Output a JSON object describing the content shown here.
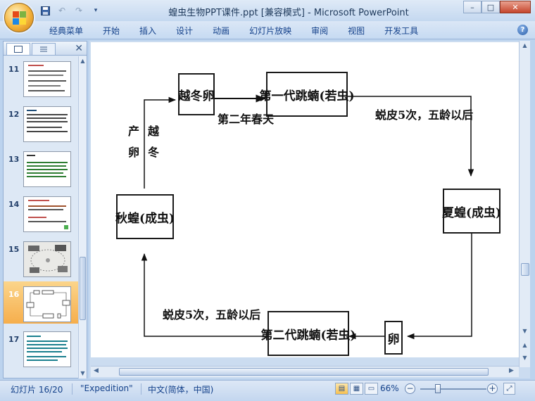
{
  "window": {
    "title": "蝗虫生物PPT课件.ppt [兼容模式] - Microsoft PowerPoint",
    "controls": {
      "minimize": "–",
      "maximize": "□",
      "close": "✕"
    }
  },
  "quick_access": {
    "save_icon": "save-icon",
    "undo_icon": "undo-icon",
    "redo_icon": "redo-icon",
    "customize_icon": "dropdown-icon"
  },
  "ribbon": {
    "tabs": [
      "经典菜单",
      "开始",
      "插入",
      "设计",
      "动画",
      "幻灯片放映",
      "审阅",
      "视图",
      "开发工具"
    ],
    "help": "?"
  },
  "slides_panel": {
    "close": "✕",
    "slides": [
      {
        "number": "11",
        "accent": "#c0504d",
        "selected": false
      },
      {
        "number": "12",
        "accent": "#1f4e79",
        "selected": false
      },
      {
        "number": "13",
        "accent": "#2e7d32",
        "selected": false
      },
      {
        "number": "14",
        "accent": "#c0504d",
        "selected": false
      },
      {
        "number": "15",
        "accent": "#777777",
        "selected": false
      },
      {
        "number": "16",
        "accent": "#333333",
        "selected": true
      },
      {
        "number": "17",
        "accent": "#1a7f8e",
        "selected": false
      }
    ]
  },
  "diagram": {
    "boxes": {
      "overwinter_egg": "越冬卵",
      "first_gen_nymph": "第一代跳蝻(若虫)",
      "summer_locust": "夏蝗(成虫)",
      "egg": "卵",
      "second_gen_nymph": "第二代跳蝻(若虫)",
      "autumn_locust": "秋蝗(成虫)"
    },
    "labels": {
      "next_spring": "第二年春天",
      "molt_top": "蜕皮5次，五龄以后",
      "molt_bottom": "蜕皮5次，五龄以后",
      "lay_eggs": "产卵",
      "overwinter": "越冬"
    }
  },
  "status_bar": {
    "slide_info": "幻灯片 16/20",
    "theme": "\"Expedition\"",
    "language": "中文(简体，中国)",
    "zoom": "66%",
    "zoom_level": 0.66
  },
  "colors": {
    "ribbon_text": "#15428b",
    "selected_thumb": "#f6ae4c",
    "close_button": "#c5452c"
  }
}
